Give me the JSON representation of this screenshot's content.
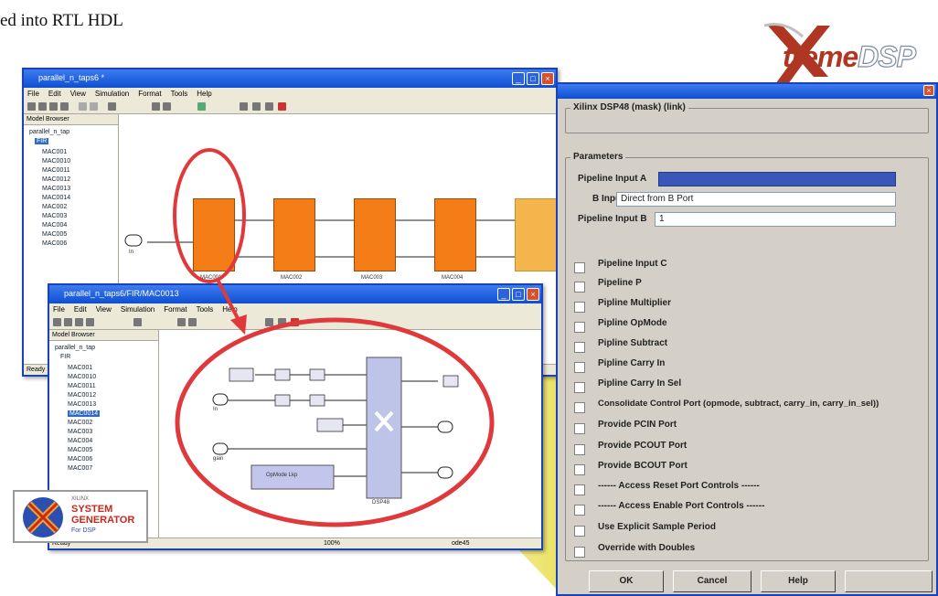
{
  "caption": "ed into RTL HDL",
  "logo": {
    "x_letter": "X",
    "treme": "treme",
    "dsp": "DSP"
  },
  "main_window": {
    "title": "parallel_n_taps6 *",
    "menu": [
      "File",
      "Edit",
      "View",
      "Simulation",
      "Format",
      "Tools",
      "Help"
    ],
    "browser_header": "Model Browser",
    "tree_root": "parallel_n_tap",
    "tree_fir": "FIR",
    "tree_items": [
      "MAC001",
      "MAC0010",
      "MAC0011",
      "MAC0012",
      "MAC0013",
      "MAC0014",
      "MAC002",
      "MAC003",
      "MAC004",
      "MAC005",
      "MAC006"
    ],
    "status": "Ready",
    "in_port": "In",
    "blocks": [
      "MAC001",
      "MAC002",
      "MAC003",
      "MAC004"
    ]
  },
  "sub_window": {
    "title": "parallel_n_taps6/FIR/MAC0013",
    "menu": [
      "File",
      "Edit",
      "View",
      "Simulation",
      "Format",
      "Tools",
      "Help"
    ],
    "browser_header": "Model Browser",
    "tree_root": "parallel_n_tap",
    "tree_fir": "FIR",
    "tree_items": [
      "MAC001",
      "MAC0010",
      "MAC0011",
      "MAC0012",
      "MAC0013",
      "MAC0014",
      "MAC002",
      "MAC003",
      "MAC004",
      "MAC005",
      "MAC006",
      "MAC007"
    ],
    "selected_index": 5,
    "status_left": "Ready",
    "status_mid": "100%",
    "status_right": "ode45",
    "ports": [
      "In",
      "gain"
    ],
    "dsp_label": "DSP48",
    "opmode_label": "OpMode Lkp"
  },
  "dialog": {
    "group1": "Xilinx DSP48 (mask) (link)",
    "group2": "Parameters",
    "pipeline_a_label": "Pipeline Input A",
    "pipeline_a_value": "",
    "b_input_label": "B Input",
    "b_input_value": "Direct from B Port",
    "pipeline_b_label": "Pipeline Input B",
    "pipeline_b_value": "1",
    "checkboxes": [
      "Pipeline Input C",
      "Pipeline P",
      "Pipline Multiplier",
      "Pipline OpMode",
      "Pipline Subtract",
      "Pipline Carry In",
      "Pipline Carry In Sel",
      "Consolidate Control Port (opmode, subtract, carry_in, carry_in_sel))",
      "Provide PCIN Port",
      "Provide PCOUT Port",
      "Provide BCOUT Port",
      "------ Access Reset Port Controls ------",
      "------ Access Enable Port Controls ------",
      "Use Explicit Sample Period",
      "Override with Doubles"
    ],
    "buttons": {
      "ok": "OK",
      "cancel": "Cancel",
      "help": "Help"
    }
  },
  "sysgen": {
    "line1": "XILINX",
    "line2": "SYSTEM",
    "line3": "GENERATOR",
    "line4": "For DSP"
  },
  "colors": {
    "accent": "#f47d17",
    "callout": "#e0393b",
    "titlebar": "#1a4fd6",
    "highlight": "#f2ee9a"
  }
}
